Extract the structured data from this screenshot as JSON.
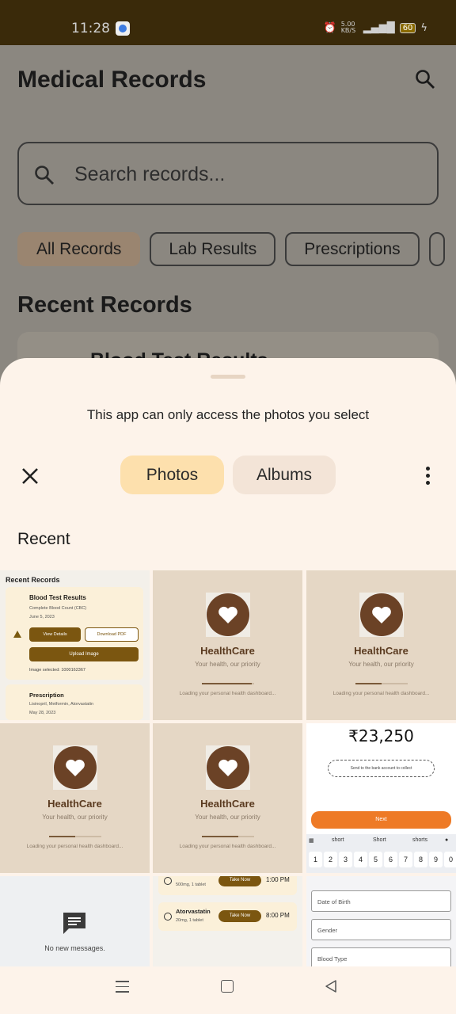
{
  "status_bar": {
    "time": "11:28",
    "network_speed": "5.00 KB/S",
    "battery": "60"
  },
  "background_app": {
    "title": "Medical Records",
    "search_placeholder": "Search records...",
    "chips": [
      "All Records",
      "Lab Results",
      "Prescriptions"
    ],
    "section_title": "Recent Records",
    "peek_card_title": "Blood Test Results"
  },
  "picker": {
    "notice": "This app can only access the photos you select",
    "tabs": {
      "photos": "Photos",
      "albums": "Albums"
    },
    "active_tab": "Photos",
    "section_label": "Recent",
    "accent_color": "#fde0ad"
  },
  "thumbs": {
    "records": {
      "title": "Recent Records",
      "card1_title": "Blood Test Results",
      "card1_subtitle": "Complete Blood Count (CBC)",
      "card1_date": "June 5, 2023",
      "view_details": "View Details",
      "download_pdf": "Download PDF",
      "upload_image": "Upload Image",
      "image_selected": "Image selected: 1000162367",
      "card2_title": "Prescription",
      "card2_subtitle": "Lisinopril, Metformin, Atorvastatin",
      "card2_date": "May 28, 2023"
    },
    "splash": {
      "name": "HealthCare",
      "tagline": "Your health, our priority",
      "loading": "Loading your personal health dashboard..."
    },
    "splash_progress": [
      0.95,
      0.5,
      0.5,
      0.7
    ],
    "payment": {
      "amount": "₹23,250",
      "note": "Send to the bank account to collect",
      "next": "Next",
      "suggestions": [
        "short",
        "Short",
        "shorts"
      ],
      "keys": [
        "1",
        "2",
        "3",
        "4",
        "5",
        "6",
        "7",
        "8",
        "9",
        "0"
      ]
    },
    "messages": {
      "text": "No new messages."
    },
    "meds": [
      {
        "dose": "500mg, 1 tablet",
        "action": "Take Now",
        "time": "1:00 PM"
      },
      {
        "name": "Atorvastatin",
        "dose": "20mg, 1 tablet",
        "action": "Take Now",
        "time": "8:00 PM"
      }
    ],
    "form_fields": [
      "Date of Birth",
      "Gender",
      "Blood Type"
    ]
  }
}
